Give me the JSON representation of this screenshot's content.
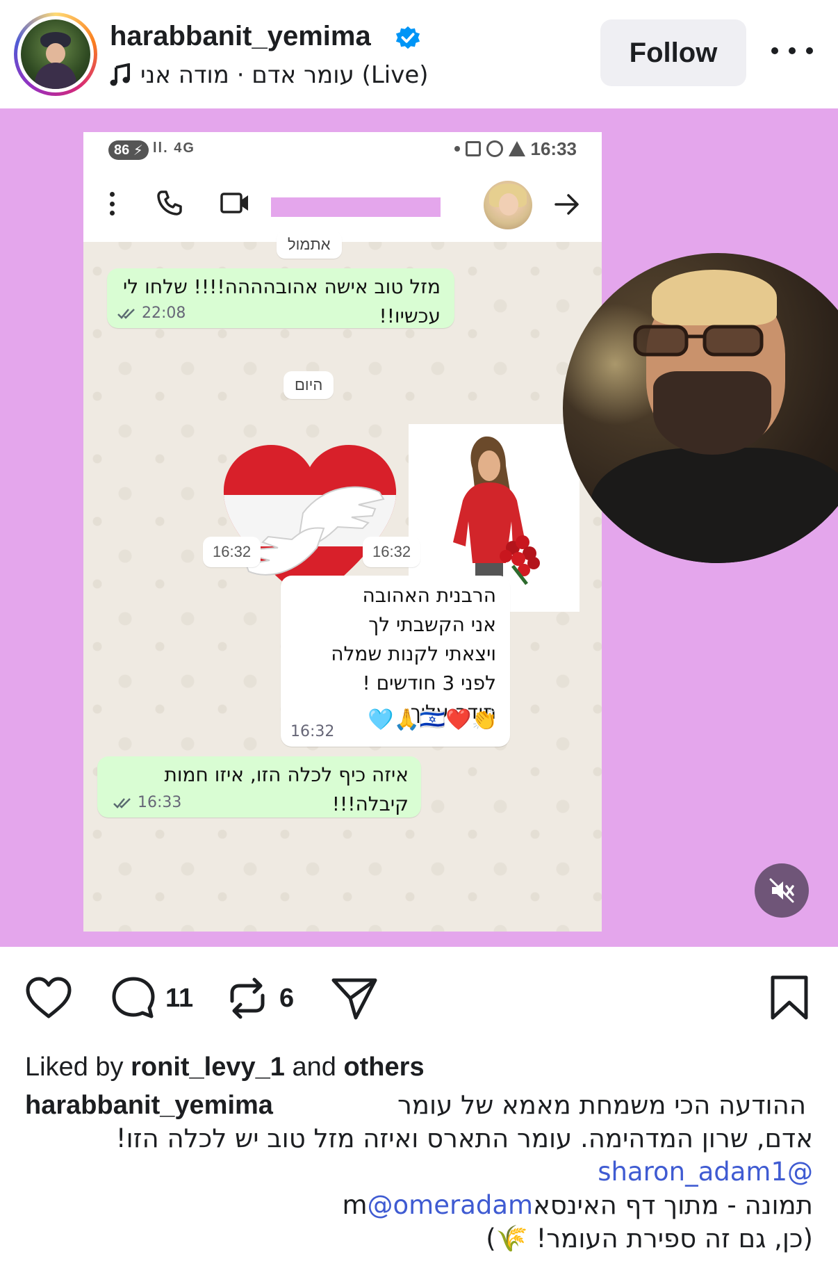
{
  "header": {
    "username": "harabbanit_yemima",
    "verified": true,
    "music": "עומר אדם · מודה אני (Live)",
    "follow_label": "Follow",
    "more_icon": "more-horizontal-icon"
  },
  "media": {
    "background_color": "#e4a6ec",
    "phone": {
      "battery": "86",
      "signal_text": "ll. 4G",
      "clock": "16:33",
      "day_yesterday": "אתמול",
      "day_today": "היום",
      "messages": [
        {
          "dir": "out",
          "text": "מזל טוב אישה אהובהההה!!!! שלחו לי עכשיו!!",
          "time": "22:08"
        },
        {
          "dir": "in",
          "lines": [
            "הרבנית האהובה",
            "אני הקשבתי לך",
            "ויצאתי לקנות שמלה",
            "לפני 3 חודשים !",
            "תודה עליך"
          ],
          "emojis": "👏❤️🇮🇱🙏🩵",
          "time": "16:32"
        },
        {
          "dir": "out",
          "text": "איזה כיף לכלה הזו, איזו חמות קיבלה!!!",
          "time": "16:33"
        }
      ],
      "sticker_heart_time": "16:32",
      "sticker_woman_time": "16:32"
    },
    "mute_icon": "speaker-muted-icon"
  },
  "actions": {
    "comments_count": "11",
    "reposts_count": "6"
  },
  "caption": {
    "liked_by_prefix": "Liked by",
    "liked_by_user": "ronit_levy_1",
    "liked_by_and": "and",
    "liked_by_others": "others",
    "username": "harabbanit_yemima",
    "line1": "ההודעה הכי משמחת מאמא של עומר",
    "line2": "אדם, שרון המדהימה. עומר התארס ואיזה מזל טוב יש לכלה הזו!",
    "mention1": "@sharon_adam1",
    "line4_text": "תמונה - מתוך דף האינסאm",
    "mention2": "@omeradam",
    "line5": "(כן, גם זה ספירת העומר! 🌾)"
  },
  "colors": {
    "mention": "#3f5bd2",
    "bubble_out": "#d9fdd3",
    "chat_bg": "#efeae2"
  }
}
